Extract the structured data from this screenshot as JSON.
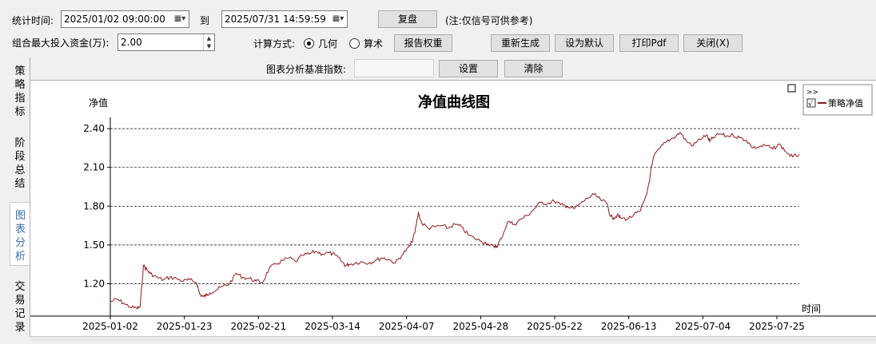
{
  "toolbar": {
    "stat_time_label": "统计时间:",
    "start_datetime": "2025/01/02 09:00:00",
    "to_label": "到",
    "end_datetime": "2025/07/31 14:59:59",
    "replay_button": "复盘",
    "note": "(注:仅信号可供参考)",
    "max_capital_label": "组合最大投入资金(万):",
    "max_capital_value": "2.00",
    "calc_method_label": "计算方式:",
    "calc_geometric": "几何",
    "calc_arithmetic": "算术",
    "calc_selected": "几何",
    "report_weight_button": "报告权重",
    "regenerate_button": "重新生成",
    "set_default_button": "设为默认",
    "print_pdf_button": "打印Pdf",
    "close_button": "关闭(X)",
    "benchmark_label": "图表分析基准指数:",
    "benchmark_value": "",
    "settings_button": "设置",
    "clear_button": "清除"
  },
  "side_tabs": [
    {
      "label": "策略指标",
      "active": false
    },
    {
      "label": "阶段总结",
      "active": false
    },
    {
      "label": "图表分析",
      "active": true
    },
    {
      "label": "交易记录",
      "active": false
    }
  ],
  "legend": {
    "expand": ">>",
    "checkbox": "√",
    "series_name": "策略净值"
  },
  "chart_data": {
    "type": "line",
    "title": "净值曲线图",
    "ylabel": "净值",
    "xlabel": "时间",
    "ylim": [
      0.95,
      2.45
    ],
    "yticks": [
      "2.40",
      "2.10",
      "1.80",
      "1.50",
      "1.20"
    ],
    "ytick_values": [
      2.4,
      2.1,
      1.8,
      1.5,
      1.2
    ],
    "xticks": [
      "2025-01-02",
      "2025-01-23",
      "2025-02-21",
      "2025-03-14",
      "2025-04-07",
      "2025-04-28",
      "2025-05-22",
      "2025-06-13",
      "2025-07-04",
      "2025-07-25"
    ],
    "grid": "horizontal dashed",
    "color": "#8b1a1a",
    "series": [
      {
        "name": "策略净值",
        "x": [
          0,
          2,
          4,
          6,
          8,
          9,
          10,
          11,
          12,
          14,
          16,
          18,
          20,
          22,
          24,
          26,
          27,
          28,
          29,
          30,
          32,
          34,
          36,
          38,
          40,
          42,
          44,
          46,
          48,
          50,
          52,
          54,
          56,
          58,
          60,
          62,
          64,
          66,
          68,
          70,
          71,
          72,
          74,
          76,
          78,
          80,
          82,
          84,
          86,
          88,
          90,
          91,
          92,
          93,
          94,
          96,
          98,
          100,
          102,
          104,
          106,
          108,
          110,
          112,
          114,
          116,
          117,
          118,
          120,
          122,
          124,
          126,
          128,
          130,
          132,
          134,
          136,
          138,
          140,
          142,
          144,
          146,
          148,
          150,
          151,
          152,
          153,
          154,
          156,
          158,
          160,
          162,
          164,
          166,
          168,
          170,
          172,
          174,
          176,
          178,
          180,
          181,
          182,
          184,
          186,
          188,
          190,
          192,
          194,
          196,
          198,
          200,
          202,
          204,
          206,
          208
        ],
        "values": [
          1.06,
          1.08,
          1.05,
          1.02,
          1.01,
          1.02,
          1.34,
          1.31,
          1.28,
          1.25,
          1.23,
          1.25,
          1.24,
          1.22,
          1.23,
          1.21,
          1.12,
          1.1,
          1.11,
          1.13,
          1.15,
          1.18,
          1.2,
          1.28,
          1.25,
          1.24,
          1.22,
          1.21,
          1.32,
          1.35,
          1.38,
          1.4,
          1.37,
          1.42,
          1.43,
          1.45,
          1.43,
          1.44,
          1.42,
          1.37,
          1.34,
          1.35,
          1.36,
          1.37,
          1.36,
          1.38,
          1.4,
          1.39,
          1.36,
          1.42,
          1.48,
          1.52,
          1.6,
          1.75,
          1.67,
          1.63,
          1.64,
          1.65,
          1.63,
          1.66,
          1.64,
          1.58,
          1.55,
          1.53,
          1.51,
          1.48,
          1.5,
          1.55,
          1.68,
          1.66,
          1.7,
          1.73,
          1.78,
          1.83,
          1.82,
          1.84,
          1.81,
          1.8,
          1.78,
          1.82,
          1.86,
          1.89,
          1.85,
          1.82,
          1.72,
          1.71,
          1.73,
          1.71,
          1.7,
          1.73,
          1.76,
          1.9,
          2.18,
          2.25,
          2.3,
          2.33,
          2.37,
          2.3,
          2.27,
          2.32,
          2.35,
          2.3,
          2.33,
          2.36,
          2.34,
          2.35,
          2.33,
          2.31,
          2.25,
          2.26,
          2.27,
          2.24,
          2.28,
          2.22,
          2.18,
          2.2
        ]
      }
    ]
  }
}
